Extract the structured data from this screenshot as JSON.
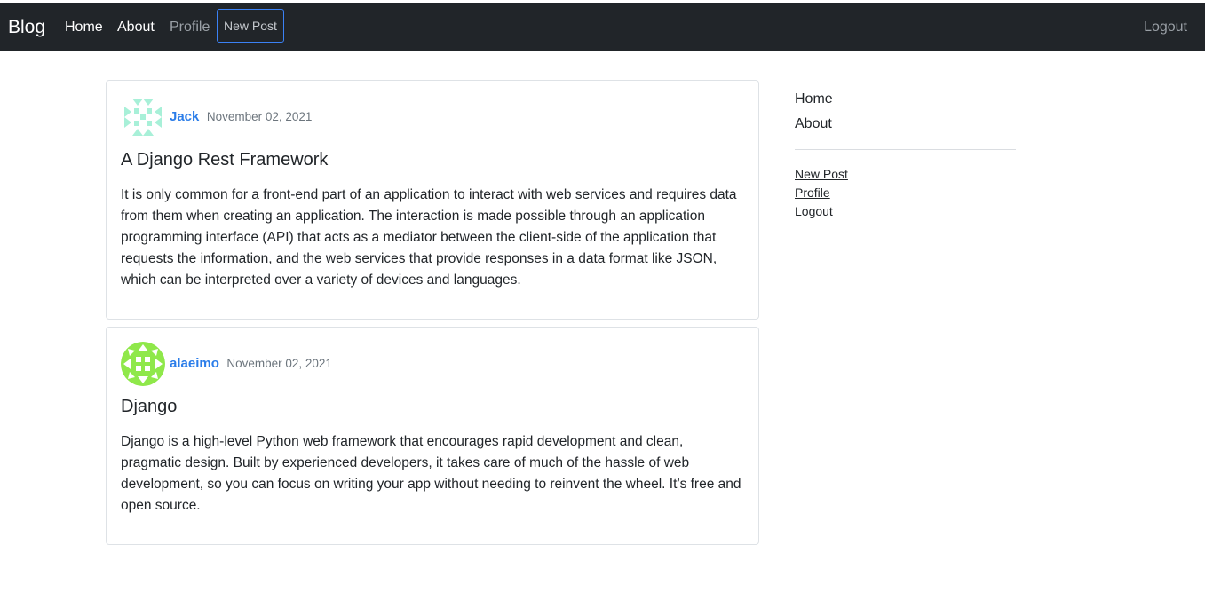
{
  "navbar": {
    "brand": "Blog",
    "links": {
      "home": "Home",
      "about": "About",
      "profile": "Profile",
      "new_post": "New Post",
      "logout": "Logout"
    }
  },
  "posts": [
    {
      "author": "Jack",
      "date": "November 02, 2021",
      "title": "A Django Rest Framework",
      "body": "It is only common for a front-end part of an application to interact with web services and requires data from them when creating an application. The interaction is made possible through an application programming interface (API) that acts as a mediator between the client-side of the application that requests the information, and the web services that provide responses in a data format like JSON, which can be interpreted over a variety of devices and languages.",
      "avatar_color": "#a8f0d8"
    },
    {
      "author": "alaeimo",
      "date": "November 02, 2021",
      "title": "Django",
      "body": "Django is a high-level Python web framework that encourages rapid development and clean, pragmatic design. Built by experienced developers, it takes care of much of the hassle of web development, so you can focus on writing your app without needing to reinvent the wheel. It’s free and open source.",
      "avatar_color": "#8fe84a"
    }
  ],
  "sidebar": {
    "primary": {
      "home": "Home",
      "about": "About"
    },
    "secondary": {
      "new_post": "New Post",
      "profile": "Profile",
      "logout": "Logout"
    }
  },
  "colors": {
    "navbar_bg": "#212529",
    "link_blue": "#2b7de9",
    "outline_button": "#3b82f6"
  }
}
